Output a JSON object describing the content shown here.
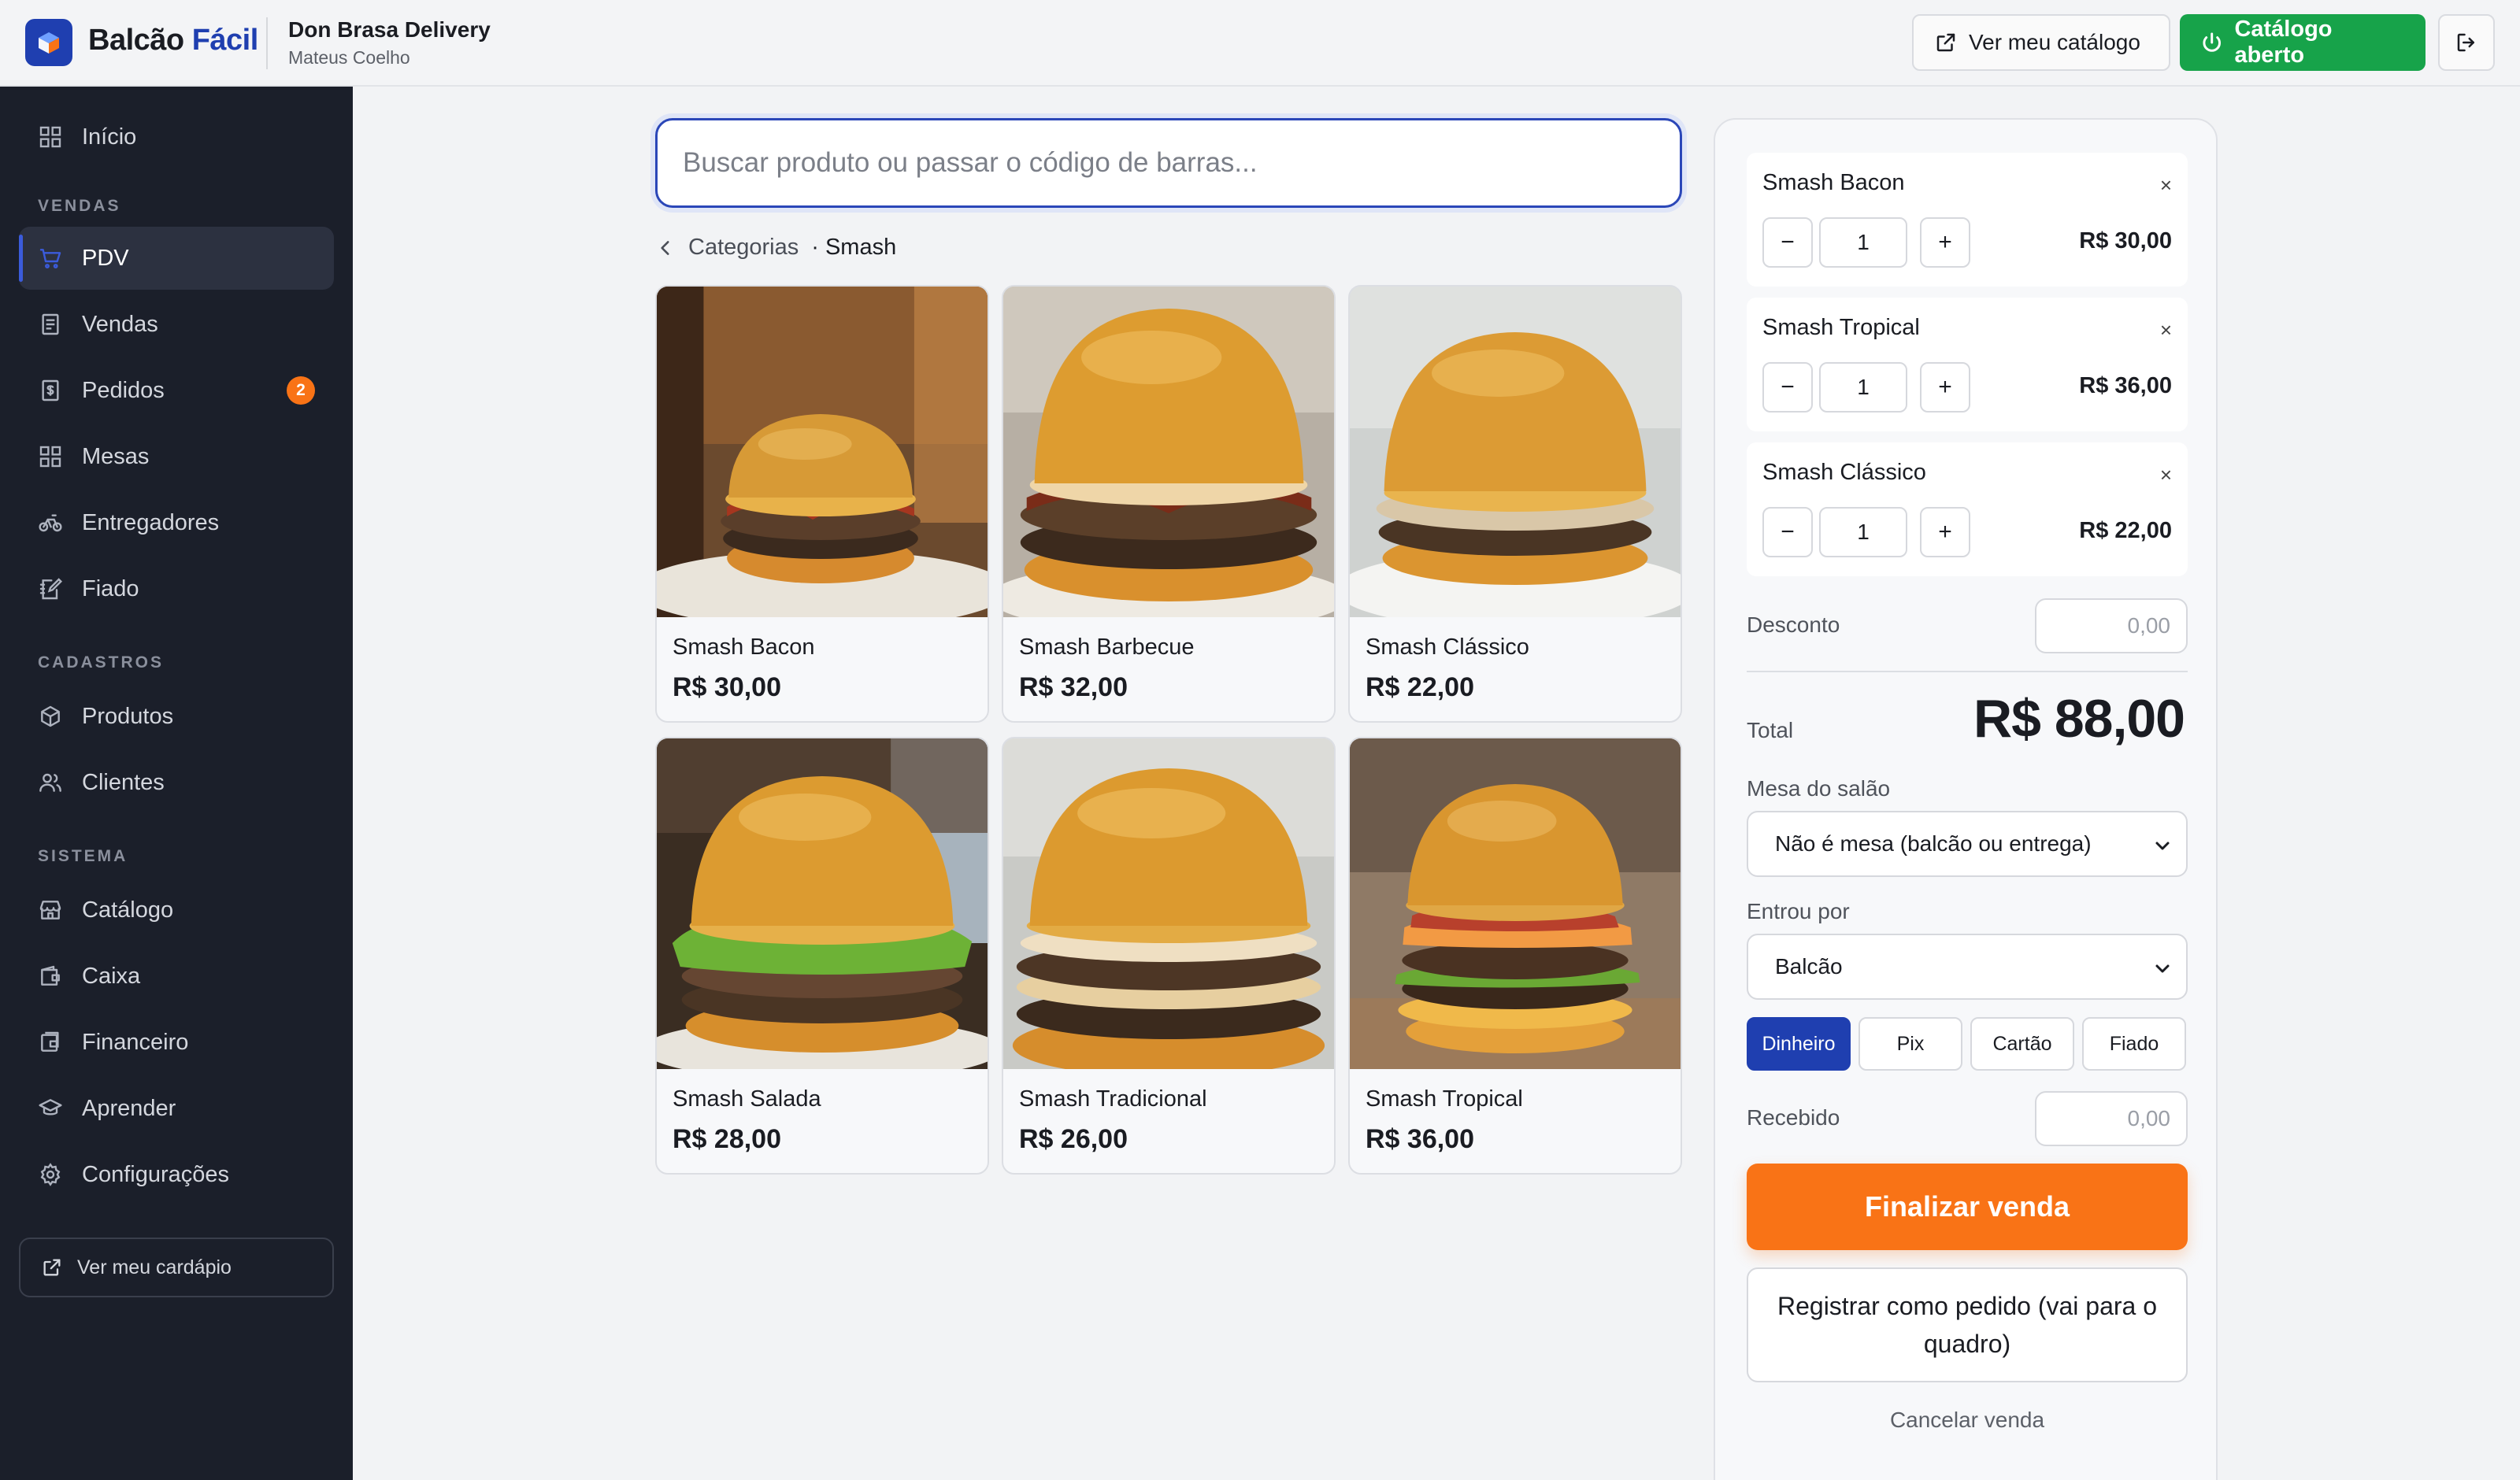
{
  "app": {
    "brand_part1": "Balcão",
    "brand_part2": "Fácil",
    "business_name": "Don Brasa Delivery",
    "user_name": "Mateus Coelho"
  },
  "header": {
    "view_catalog_label": "Ver meu catálogo",
    "catalog_status_label": "Catálogo aberto"
  },
  "sidebar": {
    "home": "Início",
    "section_sales": "VENDAS",
    "pdv": "PDV",
    "sales": "Vendas",
    "orders": "Pedidos",
    "orders_badge": "2",
    "tables": "Mesas",
    "couriers": "Entregadores",
    "credit": "Fiado",
    "section_registry": "CADASTROS",
    "products": "Produtos",
    "clients": "Clientes",
    "section_system": "SISTEMA",
    "catalog": "Catálogo",
    "cash": "Caixa",
    "financial": "Financeiro",
    "learn": "Aprender",
    "settings": "Configurações",
    "menu_link": "Ver meu cardápio"
  },
  "main": {
    "search_placeholder": "Buscar produto ou passar o código de barras...",
    "breadcrumb_root": "Categorias",
    "breadcrumb_current": "· Smash",
    "products": [
      {
        "name": "Smash Bacon",
        "price": "R$ 30,00"
      },
      {
        "name": "Smash Barbecue",
        "price": "R$ 32,00"
      },
      {
        "name": "Smash Clássico",
        "price": "R$ 22,00"
      },
      {
        "name": "Smash Salada",
        "price": "R$ 28,00"
      },
      {
        "name": "Smash Tradicional",
        "price": "R$ 26,00"
      },
      {
        "name": "Smash Tropical",
        "price": "R$ 36,00"
      }
    ]
  },
  "cart": {
    "items": [
      {
        "name": "Smash Bacon",
        "qty": "1",
        "price": "R$ 30,00"
      },
      {
        "name": "Smash Tropical",
        "qty": "1",
        "price": "R$ 36,00"
      },
      {
        "name": "Smash Clássico",
        "qty": "1",
        "price": "R$ 22,00"
      }
    ],
    "remove_glyph": "×",
    "minus_glyph": "−",
    "plus_glyph": "+",
    "discount_label": "Desconto",
    "discount_placeholder": "0,00",
    "total_label": "Total",
    "total_value": "R$ 88,00",
    "table_label": "Mesa do salão",
    "table_value": "Não é mesa (balcão ou entrega)",
    "channel_label": "Entrou por",
    "channel_value": "Balcão",
    "payment_methods": [
      "Dinheiro",
      "Pix",
      "Cartão",
      "Fiado"
    ],
    "selected_payment": "Dinheiro",
    "received_label": "Recebido",
    "received_placeholder": "0,00",
    "finalize_label": "Finalizar venda",
    "register_label": "Registrar como pedido (vai para o quadro)",
    "cancel_label": "Cancelar venda"
  },
  "colors": {
    "brand_blue": "#1f3fb0",
    "open_green": "#17a34a",
    "finalize_orange": "#f97316",
    "sidebar_bg": "#1b1f2a"
  }
}
